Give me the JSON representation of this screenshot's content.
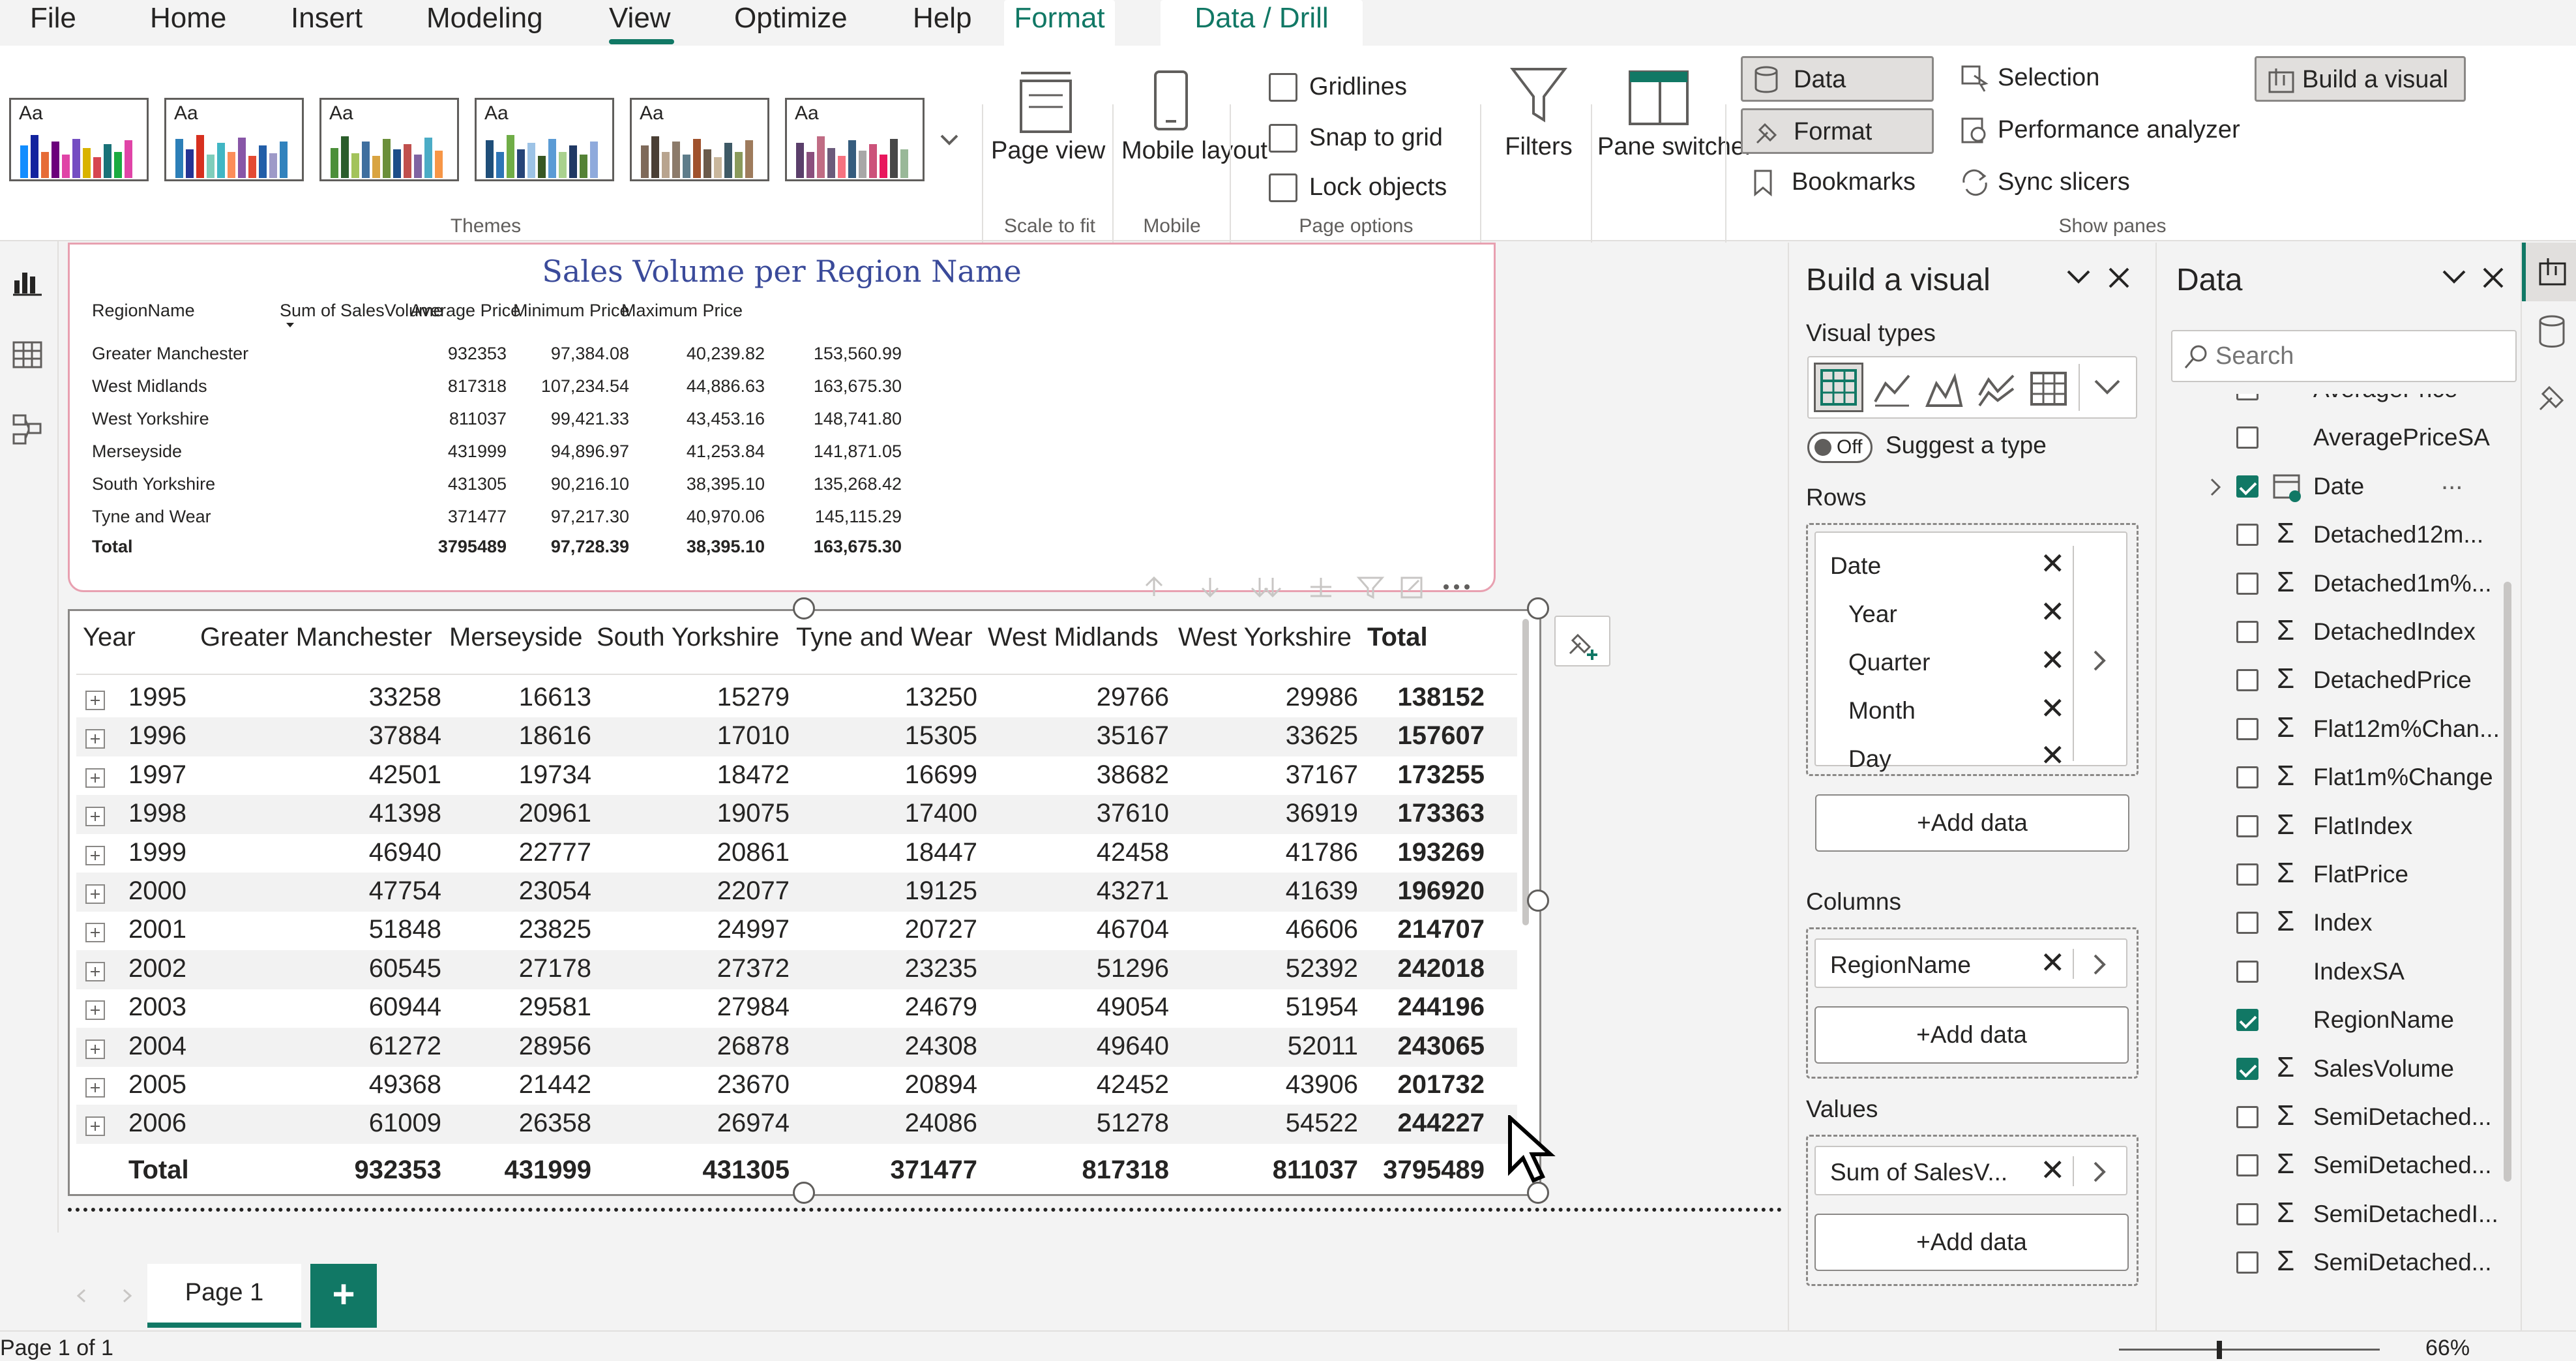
{
  "menu": {
    "items": [
      "File",
      "Home",
      "Insert",
      "Modeling",
      "View",
      "Optimize",
      "Help"
    ],
    "active": "View",
    "context_tabs": [
      "Format",
      "Data / Drill"
    ]
  },
  "ribbon": {
    "themes_label": "Themes",
    "theme_thumb_text": "Aa",
    "page_view_label": "Page view",
    "scale_to_fit_label": "Scale to fit",
    "mobile_layout_label": "Mobile layout",
    "mobile_label": "Mobile",
    "gridlines_label": "Gridlines",
    "snap_to_grid_label": "Snap to grid",
    "lock_objects_label": "Lock objects",
    "page_options_label": "Page options",
    "filters_label": "Filters",
    "pane_switcher_label": "Pane switcher",
    "data_label": "Data",
    "format_label": "Format",
    "bookmarks_label": "Bookmarks",
    "selection_label": "Selection",
    "performance_analyzer_label": "Performance analyzer",
    "sync_slicers_label": "Sync slicers",
    "build_visual_label": "Build a visual",
    "show_panes_label": "Show panes"
  },
  "visual1": {
    "title": "Sales Volume per Region Name",
    "columns": [
      "RegionName",
      "Sum of SalesVolume",
      "Average Price",
      "Minimum Price",
      "Maximum Price"
    ],
    "rows": [
      [
        "Greater Manchester",
        "932353",
        "97,384.08",
        "40,239.82",
        "153,560.99"
      ],
      [
        "West Midlands",
        "817318",
        "107,234.54",
        "44,886.63",
        "163,675.30"
      ],
      [
        "West Yorkshire",
        "811037",
        "99,421.33",
        "43,453.16",
        "148,741.80"
      ],
      [
        "Merseyside",
        "431999",
        "94,896.97",
        "41,253.84",
        "141,871.05"
      ],
      [
        "South Yorkshire",
        "431305",
        "90,216.10",
        "38,395.10",
        "135,268.42"
      ],
      [
        "Tyne and Wear",
        "371477",
        "97,217.30",
        "40,970.06",
        "145,115.29"
      ]
    ],
    "total": [
      "Total",
      "3795489",
      "97,728.39",
      "38,395.10",
      "163,675.30"
    ]
  },
  "matrix": {
    "columns": [
      "Year",
      "Greater Manchester",
      "Merseyside",
      "South Yorkshire",
      "Tyne and Wear",
      "West Midlands",
      "West Yorkshire",
      "Total"
    ],
    "rows": [
      [
        "1995",
        "33258",
        "16613",
        "15279",
        "13250",
        "29766",
        "29986",
        "138152"
      ],
      [
        "1996",
        "37884",
        "18616",
        "17010",
        "15305",
        "35167",
        "33625",
        "157607"
      ],
      [
        "1997",
        "42501",
        "19734",
        "18472",
        "16699",
        "38682",
        "37167",
        "173255"
      ],
      [
        "1998",
        "41398",
        "20961",
        "19075",
        "17400",
        "37610",
        "36919",
        "173363"
      ],
      [
        "1999",
        "46940",
        "22777",
        "20861",
        "18447",
        "42458",
        "41786",
        "193269"
      ],
      [
        "2000",
        "47754",
        "23054",
        "22077",
        "19125",
        "43271",
        "41639",
        "196920"
      ],
      [
        "2001",
        "51848",
        "23825",
        "24997",
        "20727",
        "46704",
        "46606",
        "214707"
      ],
      [
        "2002",
        "60545",
        "27178",
        "27372",
        "23235",
        "51296",
        "52392",
        "242018"
      ],
      [
        "2003",
        "60944",
        "29581",
        "27984",
        "24679",
        "49054",
        "51954",
        "244196"
      ],
      [
        "2004",
        "61272",
        "28956",
        "26878",
        "24308",
        "49640",
        "52011",
        "243065"
      ],
      [
        "2005",
        "49368",
        "21442",
        "23670",
        "20894",
        "42452",
        "43906",
        "201732"
      ],
      [
        "2006",
        "61009",
        "26358",
        "26974",
        "24086",
        "51278",
        "54522",
        "244227"
      ]
    ],
    "total": [
      "Total",
      "932353",
      "431999",
      "431305",
      "371477",
      "817318",
      "811037",
      "3795489"
    ]
  },
  "build_pane": {
    "title": "Build a visual",
    "visual_types_label": "Visual types",
    "toggle_label": "Off",
    "suggest_label": "Suggest a type",
    "rows_label": "Rows",
    "rows_fields": [
      "Date",
      "Year",
      "Quarter",
      "Month",
      "Day"
    ],
    "columns_label": "Columns",
    "columns_field": "RegionName",
    "values_label": "Values",
    "values_field": "Sum of SalesV...",
    "add_data_label": "+Add data"
  },
  "data_pane": {
    "title": "Data",
    "search_placeholder": "Search",
    "fields": [
      {
        "name": "AveragePrice",
        "sigma": false,
        "checked": false
      },
      {
        "name": "AveragePriceSA",
        "sigma": false,
        "checked": false
      },
      {
        "name": "Date",
        "sigma": false,
        "checked": true
      },
      {
        "name": "Detached12m...",
        "sigma": true,
        "checked": false
      },
      {
        "name": "Detached1m%...",
        "sigma": true,
        "checked": false
      },
      {
        "name": "DetachedIndex",
        "sigma": true,
        "checked": false
      },
      {
        "name": "DetachedPrice",
        "sigma": true,
        "checked": false
      },
      {
        "name": "Flat12m%Chan...",
        "sigma": true,
        "checked": false
      },
      {
        "name": "Flat1m%Change",
        "sigma": true,
        "checked": false
      },
      {
        "name": "FlatIndex",
        "sigma": true,
        "checked": false
      },
      {
        "name": "FlatPrice",
        "sigma": true,
        "checked": false
      },
      {
        "name": "Index",
        "sigma": true,
        "checked": false
      },
      {
        "name": "IndexSA",
        "sigma": false,
        "checked": false
      },
      {
        "name": "RegionName",
        "sigma": false,
        "checked": true
      },
      {
        "name": "SalesVolume",
        "sigma": true,
        "checked": true
      },
      {
        "name": "SemiDetached...",
        "sigma": true,
        "checked": false
      },
      {
        "name": "SemiDetached...",
        "sigma": true,
        "checked": false
      },
      {
        "name": "SemiDetachedI...",
        "sigma": true,
        "checked": false
      },
      {
        "name": "SemiDetached...",
        "sigma": true,
        "checked": false
      }
    ],
    "more_label": "..."
  },
  "pages": {
    "tabs": [
      "Page 1"
    ],
    "add_label": "+"
  },
  "status": {
    "page_info": "Page 1 of 1",
    "zoom": "66%"
  },
  "colors": {
    "accent": "#117865",
    "title_blue": "#3a4a9a",
    "visual_border_pink": "#e8a0b0"
  }
}
